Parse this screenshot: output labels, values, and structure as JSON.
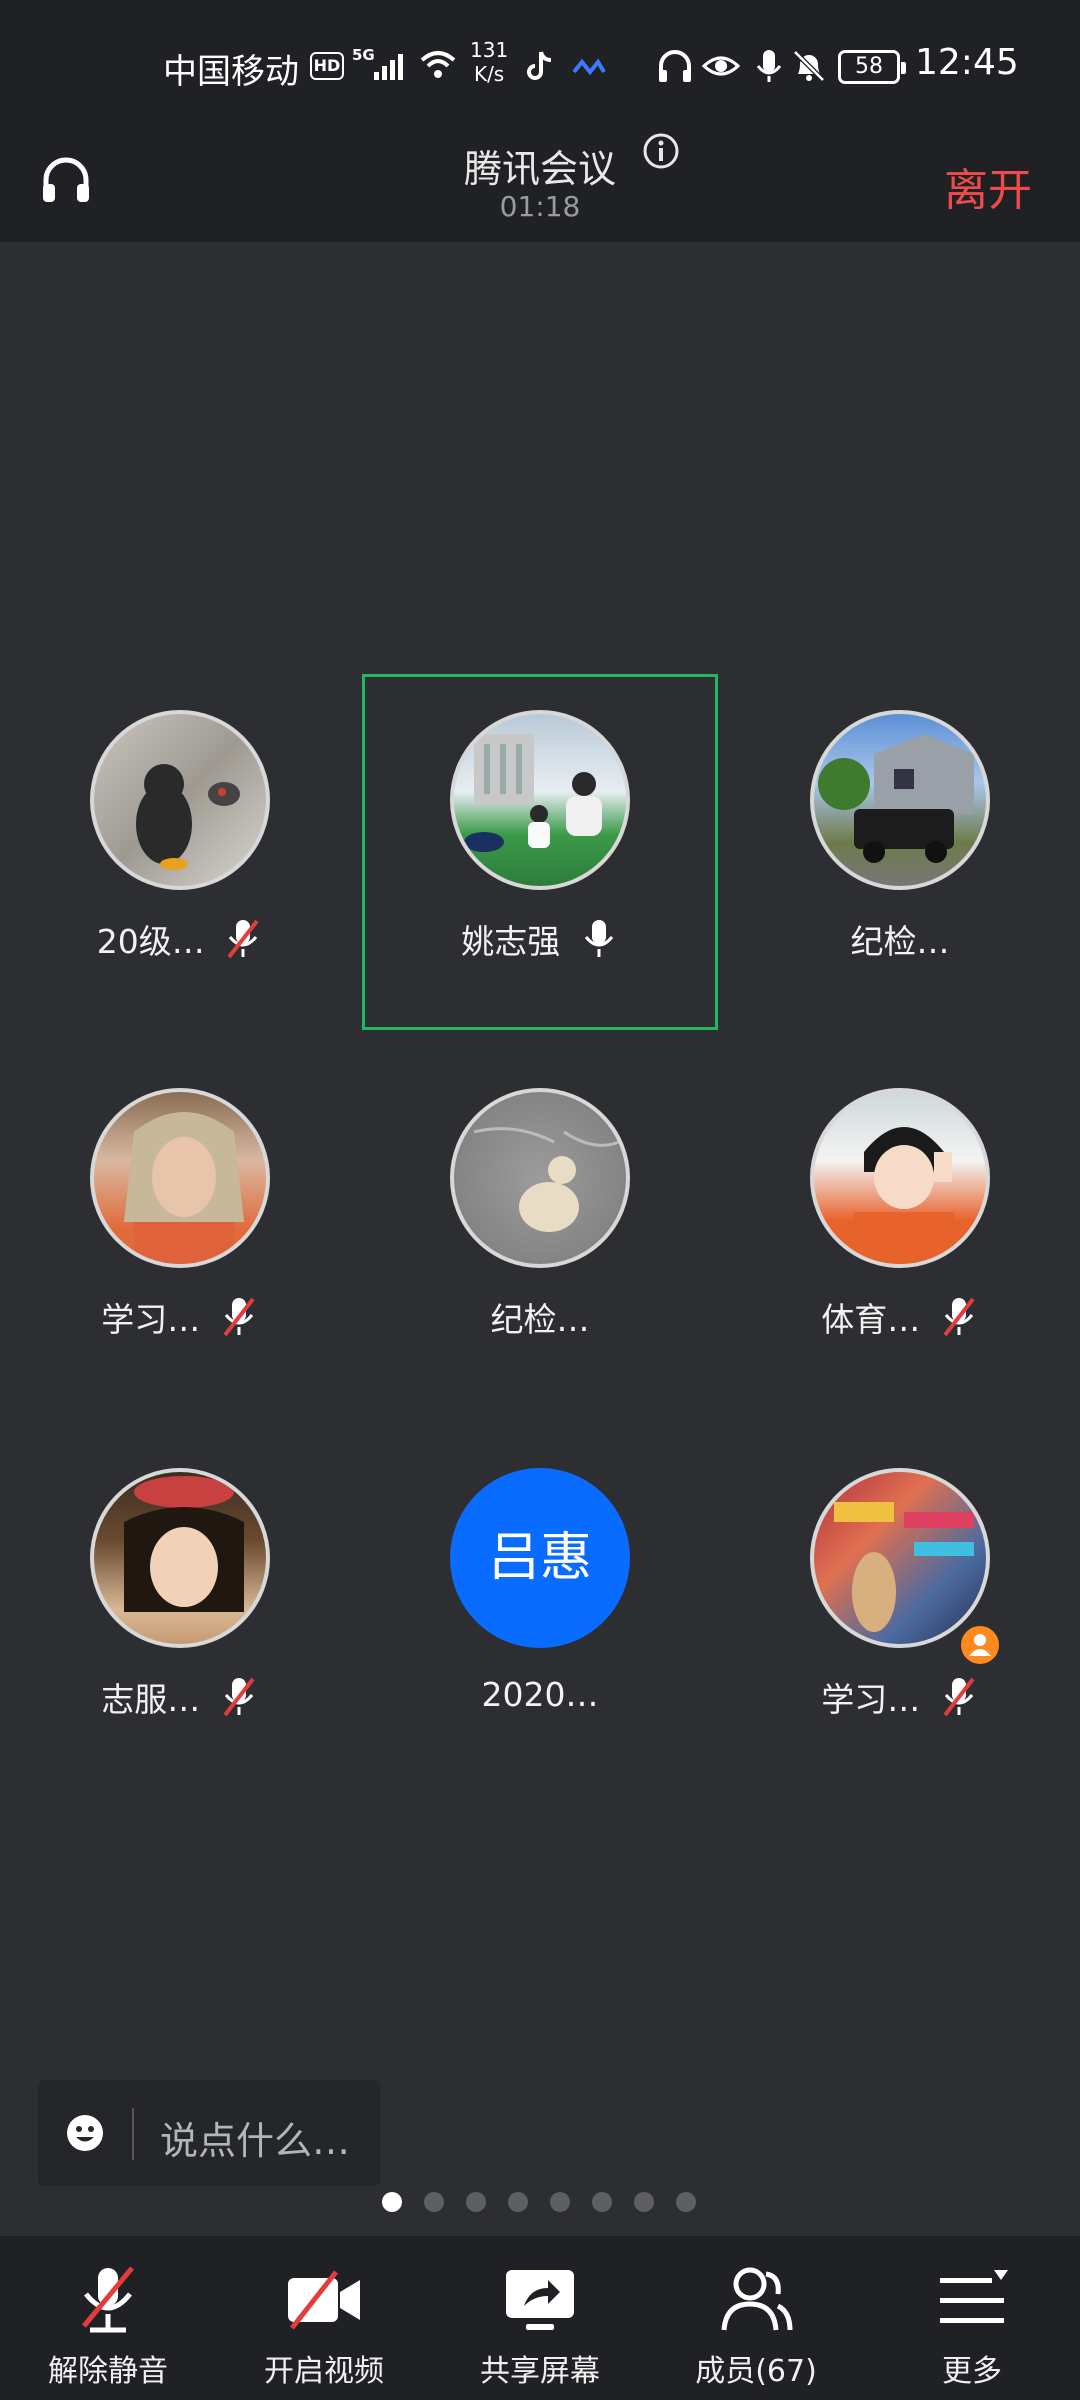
{
  "status_bar": {
    "carrier": "中国移动",
    "hd_badge": "HD",
    "network": "5G",
    "speed_value": "131",
    "speed_unit": "K/s",
    "battery": "58",
    "time": "12:45"
  },
  "header": {
    "title": "腾讯会议",
    "timer": "01:18",
    "leave_label": "离开"
  },
  "participants": [
    {
      "name": "20级…",
      "mic": "muted",
      "avatar": "photo"
    },
    {
      "name": "姚志强",
      "mic": "speaking",
      "avatar": "photo",
      "active": true
    },
    {
      "name": "纪检…",
      "mic": "none",
      "avatar": "photo"
    },
    {
      "name": "学习…",
      "mic": "muted",
      "avatar": "photo"
    },
    {
      "name": "纪检…",
      "mic": "none",
      "avatar": "photo"
    },
    {
      "name": "体育…",
      "mic": "muted",
      "avatar": "photo"
    },
    {
      "name": "志服…",
      "mic": "muted",
      "avatar": "photo"
    },
    {
      "name": "2020…",
      "mic": "none",
      "avatar_text": "吕惠"
    },
    {
      "name": "学习…",
      "mic": "muted",
      "avatar": "photo",
      "host": true
    }
  ],
  "chat": {
    "placeholder": "说点什么…"
  },
  "pagination": {
    "total": 8,
    "current": 1
  },
  "toolbar": {
    "unmute_label": "解除静音",
    "video_label": "开启视频",
    "share_label": "共享屏幕",
    "members_label": "成员(67)",
    "more_label": "更多"
  },
  "colors": {
    "background": "#2d2e32",
    "bar": "#202124",
    "leave": "#f04b4b",
    "active_border": "#1fb85a",
    "muted_slash": "#e23c3c",
    "avatar_blue": "#0a6cff"
  }
}
